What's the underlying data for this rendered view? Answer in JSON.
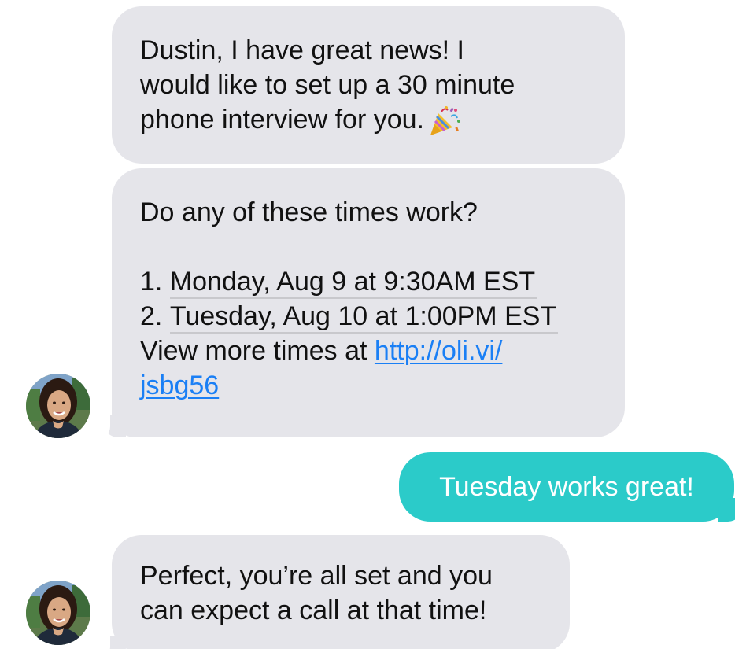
{
  "conversation": {
    "messages": [
      {
        "sender": "recruiter",
        "lines": [
          "Dustin, I have great news! I",
          "would like to set up a 30 minute",
          "phone interview for you."
        ],
        "emoji": "party-popper-icon"
      },
      {
        "sender": "recruiter",
        "intro": "Do any of these times work?",
        "options": [
          {
            "prefix": "1. ",
            "text": "Monday, Aug 9 at 9:30AM EST"
          },
          {
            "prefix": "2. ",
            "text": "Tuesday, Aug 10 at 1:00PM EST"
          }
        ],
        "more_prefix": "View more times at ",
        "link_part1": "http://oli.vi/",
        "link_part2": "jsbg56"
      },
      {
        "sender": "user",
        "text": "Tuesday works great!"
      },
      {
        "sender": "recruiter",
        "lines": [
          "Perfect, you’re all set and you",
          "can expect a call at that time!"
        ]
      }
    ]
  },
  "colors": {
    "incoming_bubble": "#e5e5ea",
    "outgoing_bubble": "#2bcbc9",
    "link": "#1a7ff5"
  }
}
